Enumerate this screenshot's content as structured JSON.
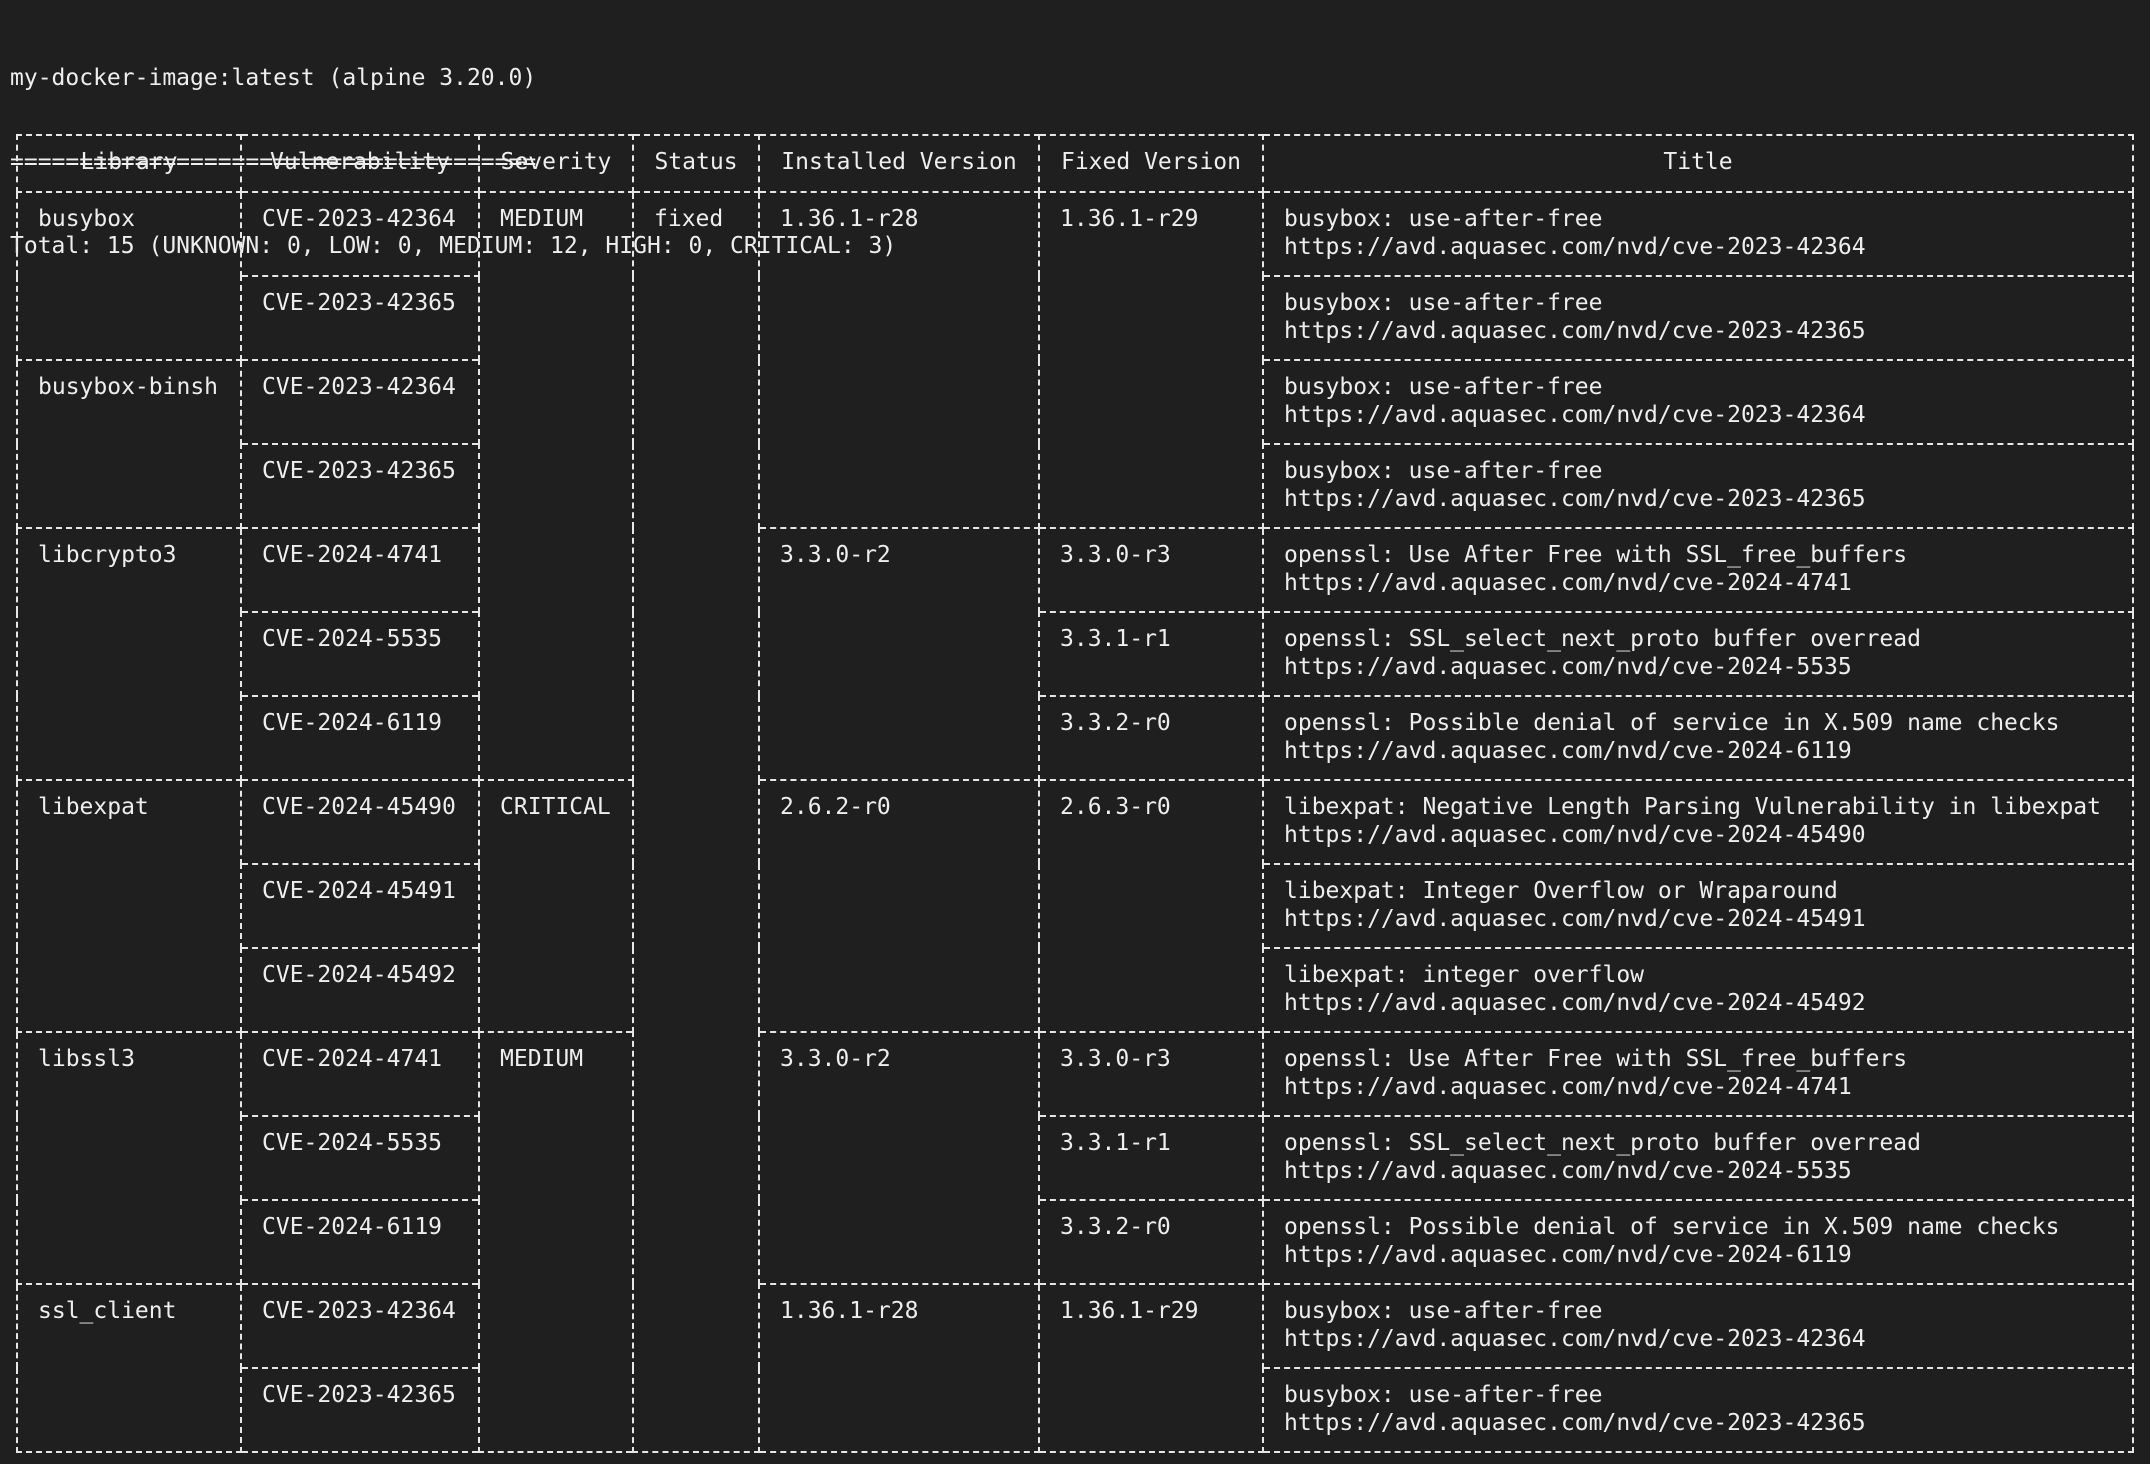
{
  "header": {
    "image_line": "my-docker-image:latest (alpine 3.20.0)",
    "separator": "======================================",
    "total_line": "Total: 15 (UNKNOWN: 0, LOW: 0, MEDIUM: 12, HIGH: 0, CRITICAL: 3)"
  },
  "table": {
    "columns": [
      "Library",
      "Vulnerability",
      "Severity",
      "Status",
      "Installed Version",
      "Fixed Version",
      "Title"
    ],
    "rows": [
      {
        "library": "busybox",
        "vulnerability": "CVE-2023-42364",
        "severity": "MEDIUM",
        "status": "fixed",
        "installed": "1.36.1-r28",
        "fixed": "1.36.1-r29",
        "title": "busybox: use-after-free",
        "url": "https://avd.aquasec.com/nvd/cve-2023-42364"
      },
      {
        "vulnerability": "CVE-2023-42365",
        "title": "busybox: use-after-free",
        "url": "https://avd.aquasec.com/nvd/cve-2023-42365"
      },
      {
        "library": "busybox-binsh",
        "vulnerability": "CVE-2023-42364",
        "title": "busybox: use-after-free",
        "url": "https://avd.aquasec.com/nvd/cve-2023-42364"
      },
      {
        "vulnerability": "CVE-2023-42365",
        "title": "busybox: use-after-free",
        "url": "https://avd.aquasec.com/nvd/cve-2023-42365"
      },
      {
        "library": "libcrypto3",
        "vulnerability": "CVE-2024-4741",
        "installed": "3.3.0-r2",
        "fixed": "3.3.0-r3",
        "title": "openssl: Use After Free with SSL_free_buffers",
        "url": "https://avd.aquasec.com/nvd/cve-2024-4741"
      },
      {
        "vulnerability": "CVE-2024-5535",
        "fixed": "3.3.1-r1",
        "title": "openssl: SSL_select_next_proto buffer overread",
        "url": "https://avd.aquasec.com/nvd/cve-2024-5535"
      },
      {
        "vulnerability": "CVE-2024-6119",
        "fixed": "3.3.2-r0",
        "title": "openssl: Possible denial of service in X.509 name checks",
        "url": "https://avd.aquasec.com/nvd/cve-2024-6119"
      },
      {
        "library": "libexpat",
        "vulnerability": "CVE-2024-45490",
        "severity": "CRITICAL",
        "installed": "2.6.2-r0",
        "fixed": "2.6.3-r0",
        "title": "libexpat: Negative Length Parsing Vulnerability in libexpat",
        "url": "https://avd.aquasec.com/nvd/cve-2024-45490"
      },
      {
        "vulnerability": "CVE-2024-45491",
        "title": "libexpat: Integer Overflow or Wraparound",
        "url": "https://avd.aquasec.com/nvd/cve-2024-45491"
      },
      {
        "vulnerability": "CVE-2024-45492",
        "title": "libexpat: integer overflow",
        "url": "https://avd.aquasec.com/nvd/cve-2024-45492"
      },
      {
        "library": "libssl3",
        "vulnerability": "CVE-2024-4741",
        "severity": "MEDIUM",
        "installed": "3.3.0-r2",
        "fixed": "3.3.0-r3",
        "title": "openssl: Use After Free with SSL_free_buffers",
        "url": "https://avd.aquasec.com/nvd/cve-2024-4741"
      },
      {
        "vulnerability": "CVE-2024-5535",
        "fixed": "3.3.1-r1",
        "title": "openssl: SSL_select_next_proto buffer overread",
        "url": "https://avd.aquasec.com/nvd/cve-2024-5535"
      },
      {
        "vulnerability": "CVE-2024-6119",
        "fixed": "3.3.2-r0",
        "title": "openssl: Possible denial of service in X.509 name checks",
        "url": "https://avd.aquasec.com/nvd/cve-2024-6119"
      },
      {
        "library": "ssl_client",
        "vulnerability": "CVE-2023-42364",
        "installed": "1.36.1-r28",
        "fixed": "1.36.1-r29",
        "title": "busybox: use-after-free",
        "url": "https://avd.aquasec.com/nvd/cve-2023-42364"
      },
      {
        "vulnerability": "CVE-2023-42365",
        "title": "busybox: use-after-free",
        "url": "https://avd.aquasec.com/nvd/cve-2023-42365"
      }
    ]
  }
}
